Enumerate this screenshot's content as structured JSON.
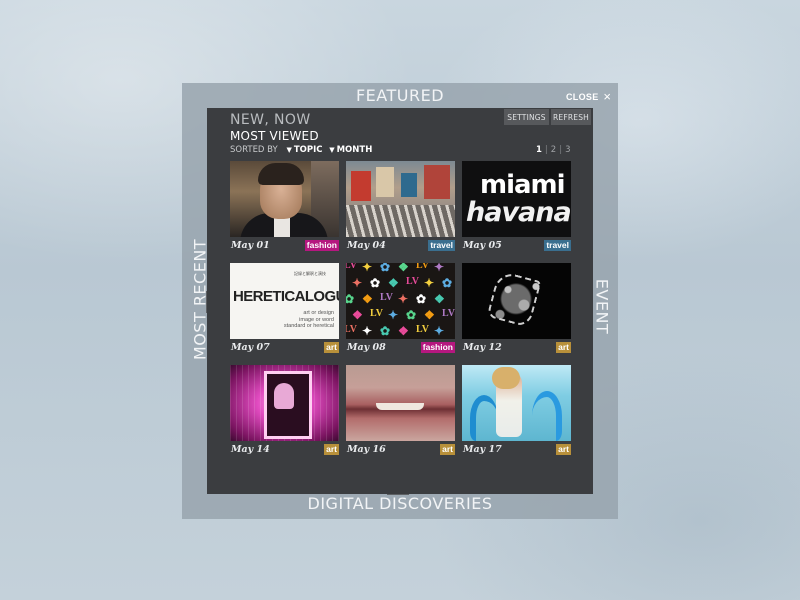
{
  "frame": {
    "top_label": "FEATURED",
    "bottom_label": "DIGITAL DISCOVERIES",
    "left_label": "MOST RECENT",
    "right_label": "EVENT",
    "close_label": "CLOSE",
    "close_icon": "×"
  },
  "header": {
    "title": "NEW, NOW",
    "subtitle": "MOST VIEWED",
    "sorted_by_label": "SORTED BY",
    "sort_topic": "TOPIC",
    "sort_month": "MONTH",
    "settings_label": "SETTINGS",
    "refresh_label": "REFRESH",
    "pages": [
      "1",
      "2",
      "3"
    ],
    "active_page": "1"
  },
  "thumbnails": {
    "t3": {
      "line1": "miami",
      "line2": "havana"
    },
    "t4": {
      "small": "記録と解釈と演技",
      "title": "HERETICALOGUE",
      "sub1": "art or design",
      "sub2": "image or word",
      "sub3": "standard or heretical"
    },
    "t5_monogram": "LV"
  },
  "tiles": [
    {
      "date": "May 01",
      "tag": "fashion",
      "tag_color": "#b5177f"
    },
    {
      "date": "May 04",
      "tag": "travel",
      "tag_color": "#3a6f8f"
    },
    {
      "date": "May 05",
      "tag": "travel",
      "tag_color": "#3a6f8f"
    },
    {
      "date": "May 07",
      "tag": "art",
      "tag_color": "#b8903a"
    },
    {
      "date": "May 08",
      "tag": "fashion",
      "tag_color": "#b5177f"
    },
    {
      "date": "May 12",
      "tag": "art",
      "tag_color": "#b8903a"
    },
    {
      "date": "May 14",
      "tag": "art",
      "tag_color": "#b8903a"
    },
    {
      "date": "May 16",
      "tag": "art",
      "tag_color": "#b8903a"
    },
    {
      "date": "May 17",
      "tag": "art",
      "tag_color": "#b8903a"
    }
  ]
}
